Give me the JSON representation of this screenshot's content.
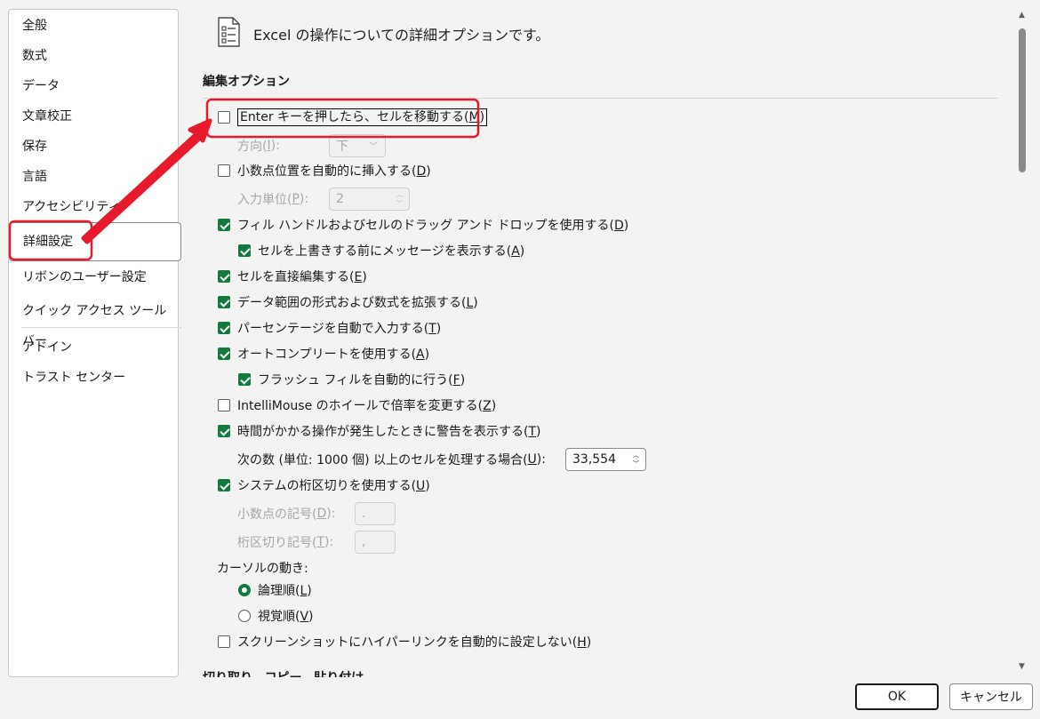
{
  "sidebar": {
    "items": [
      {
        "label": "全般"
      },
      {
        "label": "数式"
      },
      {
        "label": "データ"
      },
      {
        "label": "文章校正"
      },
      {
        "label": "保存"
      },
      {
        "label": "言語"
      },
      {
        "label": "アクセシビリティ"
      },
      {
        "label": "詳細設定",
        "selected": true
      },
      {
        "label": "リボンのユーザー設定"
      },
      {
        "label": "クイック アクセス ツール バー"
      },
      {
        "label": "アドイン"
      },
      {
        "label": "トラスト センター"
      }
    ]
  },
  "header": {
    "title": "Excel の操作についての詳細オプションです。",
    "icon": "options-list-icon"
  },
  "sections": {
    "edit_options": "編集オプション",
    "next_section_partial": "切り取り、コピー、貼り付け"
  },
  "options": {
    "move_after_enter": {
      "label": "Enter キーを押したら、セルを移動する(",
      "key": "M",
      "close": ")",
      "checked": false
    },
    "direction_label": {
      "label": "方向(",
      "key": "I",
      "close": "):"
    },
    "direction_value": "下",
    "auto_decimal": {
      "label": "小数点位置を自動的に挿入する(",
      "key": "D",
      "close": ")",
      "checked": false
    },
    "places_label": {
      "label": "入力単位(",
      "key": "P",
      "close": "):"
    },
    "places_value": "2",
    "fill_handle": {
      "label": "フィル ハンドルおよびセルのドラッグ アンド ドロップを使用する(",
      "key": "D",
      "close": ")",
      "checked": true
    },
    "alert_overwrite": {
      "label": "セルを上書きする前にメッセージを表示する(",
      "key": "A",
      "close": ")",
      "checked": true
    },
    "edit_in_cell": {
      "label": "セルを直接編集する(",
      "key": "E",
      "close": ")",
      "checked": true
    },
    "extend_formats": {
      "label": "データ範囲の形式および数式を拡張する(",
      "key": "L",
      "close": ")",
      "checked": true
    },
    "auto_percent": {
      "label": "パーセンテージを自動で入力する(",
      "key": "T",
      "close": ")",
      "checked": true
    },
    "autocomplete": {
      "label": "オートコンプリートを使用する(",
      "key": "A",
      "close": ")",
      "checked": true
    },
    "flash_fill": {
      "label": "フラッシュ フィルを自動的に行う(",
      "key": "F",
      "close": ")",
      "checked": true
    },
    "intellimouse": {
      "label": "IntelliMouse のホイールで倍率を変更する(",
      "key": "Z",
      "close": ")",
      "checked": false
    },
    "alert_slow": {
      "label": "時間がかかる操作が発生したときに警告を表示する(",
      "key": "T",
      "close": ")",
      "checked": true
    },
    "cells_threshold_label": {
      "label": "次の数 (単位: 1000 個) 以上のセルを処理する場合(",
      "key": "U",
      "close": "):"
    },
    "cells_threshold_value": "33,554",
    "system_separators": {
      "label": "システムの桁区切りを使用する(",
      "key": "U",
      "close": ")",
      "checked": true
    },
    "decimal_sep_label": {
      "label": "小数点の記号(",
      "key": "D",
      "close": "):"
    },
    "decimal_sep_value": ".",
    "thousands_sep_label": {
      "label": "桁区切り記号(",
      "key": "T",
      "close": "):"
    },
    "thousands_sep_value": ",",
    "cursor_movement": "カーソルの動き:",
    "logical": {
      "label": "論理順(",
      "key": "L",
      "close": ")",
      "selected": true
    },
    "visual": {
      "label": "視覚順(",
      "key": "V",
      "close": ")",
      "selected": false
    },
    "no_hyperlink_screenshot": {
      "label": "スクリーンショットにハイパーリンクを自動的に設定しない(",
      "key": "H",
      "close": ")",
      "checked": false
    }
  },
  "buttons": {
    "ok": "OK",
    "cancel": "キャンセル"
  },
  "colors": {
    "accent": "#117a3e",
    "annotation": "#e8192c"
  }
}
